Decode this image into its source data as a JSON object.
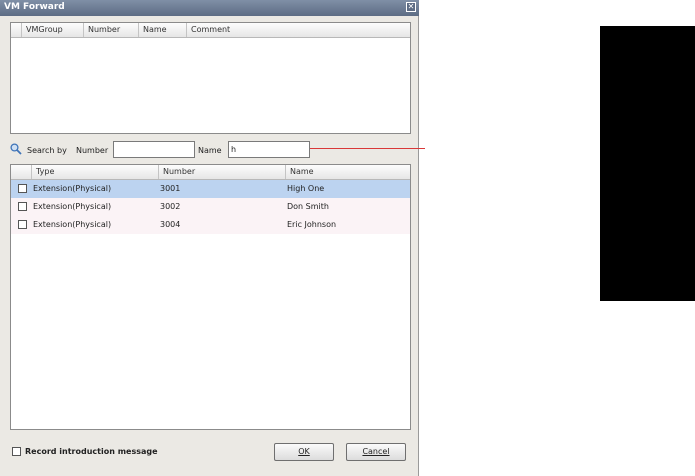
{
  "window": {
    "title": "VM Forward",
    "close_glyph": "✕"
  },
  "vm_group_table": {
    "columns": [
      "VMGroup",
      "Number",
      "Name",
      "Comment"
    ]
  },
  "search": {
    "by_label": "Search by",
    "number_label": "Number",
    "number_value": "",
    "name_label": "Name",
    "name_value": "h"
  },
  "results_table": {
    "columns": [
      "Type",
      "Number",
      "Name"
    ],
    "rows": [
      {
        "type": "Extension(Physical)",
        "number": "3001",
        "name": "High One",
        "selected": true
      },
      {
        "type": "Extension(Physical)",
        "number": "3002",
        "name": "Don Smith",
        "selected": false
      },
      {
        "type": "Extension(Physical)",
        "number": "3004",
        "name": "Eric Johnson",
        "selected": false
      }
    ]
  },
  "footer": {
    "record_intro_label": "Record introduction message",
    "record_intro_checked": false,
    "ok_label": "OK",
    "cancel_label": "Cancel"
  },
  "colors": {
    "selected_row": "#bcd3f0",
    "alt_row": "#fbf3f6",
    "callout": "#d93838"
  }
}
